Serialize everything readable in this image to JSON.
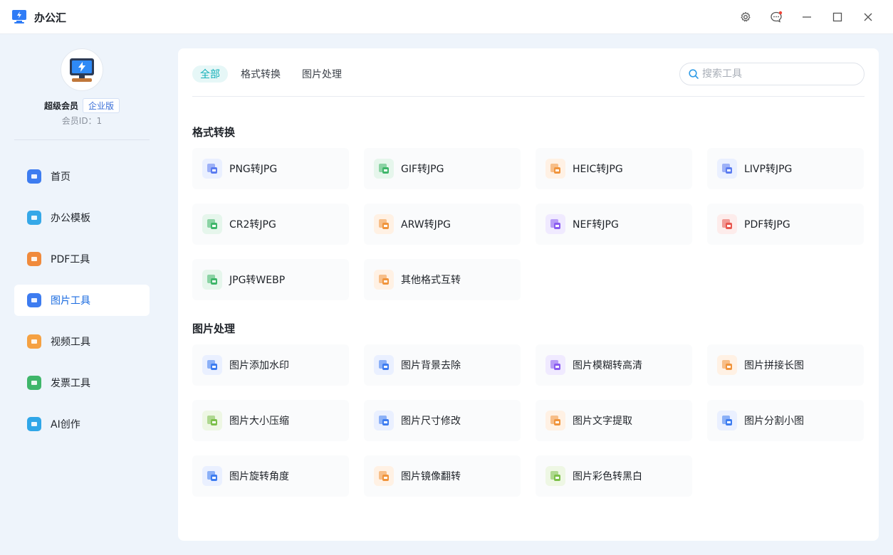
{
  "app": {
    "title": "办公汇"
  },
  "user": {
    "name": "超级会员",
    "badge": "企业版",
    "member_id": "会员ID：1"
  },
  "sidebar": {
    "items": [
      {
        "label": "首页",
        "icon": "home-icon",
        "color": "#3d7cf0"
      },
      {
        "label": "办公模板",
        "icon": "briefcase-icon",
        "color": "#35a8e8"
      },
      {
        "label": "PDF工具",
        "icon": "pdf-file-icon",
        "color": "#f08a3c"
      },
      {
        "label": "图片工具",
        "icon": "image-icon",
        "color": "#3d7cf0"
      },
      {
        "label": "视频工具",
        "icon": "video-icon",
        "color": "#f5a142"
      },
      {
        "label": "发票工具",
        "icon": "invoice-icon",
        "color": "#3fb66a"
      },
      {
        "label": "AI创作",
        "icon": "ai-icon",
        "color": "#2fa6e8"
      }
    ],
    "active_index": 3
  },
  "tabs": [
    {
      "label": "全部",
      "active": true
    },
    {
      "label": "格式转换",
      "active": false
    },
    {
      "label": "图片处理",
      "active": false
    }
  ],
  "search": {
    "placeholder": "搜索工具"
  },
  "sections": [
    {
      "title": "格式转换",
      "tools": [
        {
          "label": "PNG转JPG",
          "icon": "png-convert-icon",
          "color": "#5b7cf0",
          "bg": "#eaf0ff"
        },
        {
          "label": "GIF转JPG",
          "icon": "gif-convert-icon",
          "color": "#3fb66a",
          "bg": "#e6f6ec"
        },
        {
          "label": "HEIC转JPG",
          "icon": "heic-convert-icon",
          "color": "#f0943c",
          "bg": "#fff1e4"
        },
        {
          "label": "LIVP转JPG",
          "icon": "livp-convert-icon",
          "color": "#5b7cf0",
          "bg": "#eaf0ff"
        },
        {
          "label": "CR2转JPG",
          "icon": "cr2-convert-icon",
          "color": "#3fb66a",
          "bg": "#e6f6ec"
        },
        {
          "label": "ARW转JPG",
          "icon": "arw-convert-icon",
          "color": "#f0943c",
          "bg": "#fff1e4"
        },
        {
          "label": "NEF转JPG",
          "icon": "nef-convert-icon",
          "color": "#8a5cf0",
          "bg": "#f0eaff"
        },
        {
          "label": "PDF转JPG",
          "icon": "pdf-convert-icon",
          "color": "#e8574f",
          "bg": "#fdeceb"
        },
        {
          "label": "JPG转WEBP",
          "icon": "webp-convert-icon",
          "color": "#3fb66a",
          "bg": "#e6f6ec"
        },
        {
          "label": "其他格式互转",
          "icon": "format-swap-icon",
          "color": "#f0943c",
          "bg": "#fff1e4"
        }
      ]
    },
    {
      "title": "图片处理",
      "tools": [
        {
          "label": "图片添加水印",
          "icon": "watermark-icon",
          "color": "#3d7cf0",
          "bg": "#eaf0ff"
        },
        {
          "label": "图片背景去除",
          "icon": "background-remove-icon",
          "color": "#3d7cf0",
          "bg": "#eaf0ff"
        },
        {
          "label": "图片模糊转高清",
          "icon": "enhance-icon",
          "color": "#8a5cf0",
          "bg": "#f0eaff"
        },
        {
          "label": "图片拼接长图",
          "icon": "stitch-icon",
          "color": "#f0943c",
          "bg": "#fff1e4"
        },
        {
          "label": "图片大小压缩",
          "icon": "compress-icon",
          "color": "#7cc04a",
          "bg": "#eef7e4"
        },
        {
          "label": "图片尺寸修改",
          "icon": "resize-icon",
          "color": "#3d7cf0",
          "bg": "#eaf0ff"
        },
        {
          "label": "图片文字提取",
          "icon": "text-extract-icon",
          "color": "#f0943c",
          "bg": "#fff1e4"
        },
        {
          "label": "图片分割小图",
          "icon": "split-icon",
          "color": "#3d7cf0",
          "bg": "#eaf0ff"
        },
        {
          "label": "图片旋转角度",
          "icon": "rotate-icon",
          "color": "#3d7cf0",
          "bg": "#eaf0ff"
        },
        {
          "label": "图片镜像翻转",
          "icon": "mirror-flip-icon",
          "color": "#f0943c",
          "bg": "#fff1e4"
        },
        {
          "label": "图片彩色转黑白",
          "icon": "palette-icon",
          "color": "#7cc04a",
          "bg": "#eef7e4"
        }
      ]
    }
  ]
}
